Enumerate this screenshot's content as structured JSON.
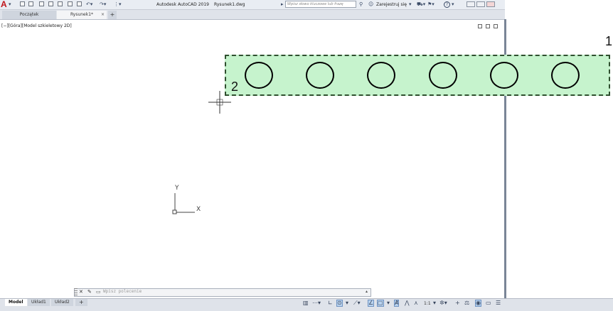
{
  "titlebar": {
    "app_name": "Autodesk AutoCAD 2019",
    "file_name": "Rysunek1.dwg",
    "search_placeholder": "Wpisz słowo kluczowe lub frazę",
    "sign_in": "Zarejestruj się",
    "help": "?"
  },
  "tabs": {
    "start": "Początek",
    "drawing": "Rysunek1*",
    "close": "×",
    "add": "+"
  },
  "viewport": {
    "label": "[−][Góra][Model szkieletowy 2D]"
  },
  "callouts": {
    "one": "1",
    "two": "2"
  },
  "ucs": {
    "x_label": "X",
    "y_label": "Y"
  },
  "command_line": {
    "placeholder": "Wpisz polecenie"
  },
  "layout_tabs": {
    "model": "Model",
    "layout1": "Układ1",
    "layout2": "Układ2",
    "add": "+"
  },
  "statusbar": {
    "scale": "1:1"
  },
  "colors": {
    "selection_fill": "#c6f3cd",
    "selection_border": "#2f4f2f"
  }
}
